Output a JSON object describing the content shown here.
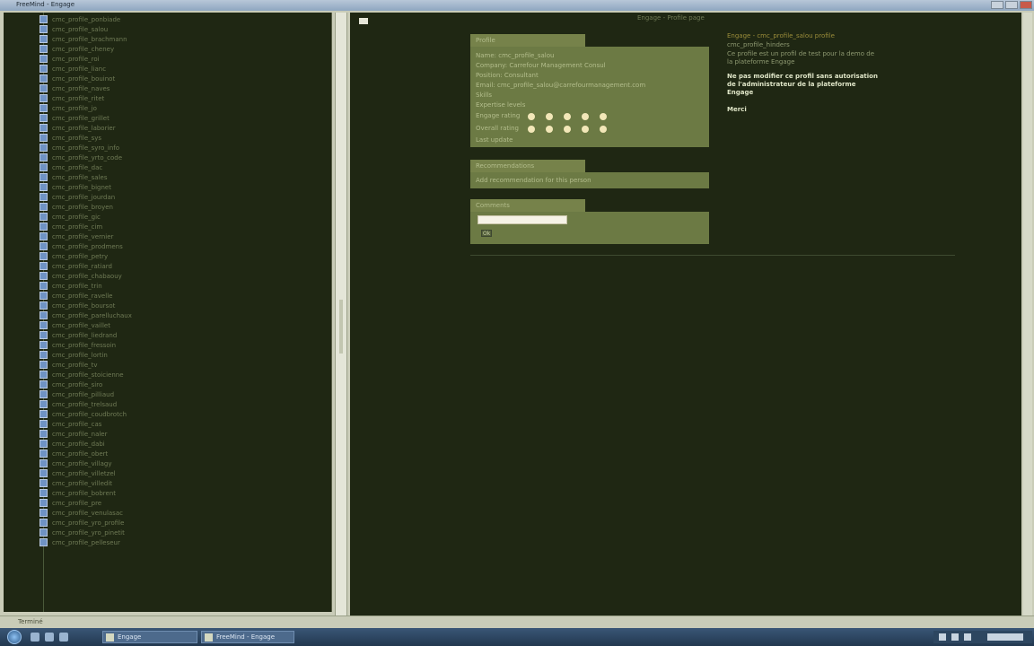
{
  "window": {
    "title": "FreeMind - Engage"
  },
  "tree": {
    "items": [
      "cmc_profile_ponbiade",
      "cmc_profile_salou",
      "cmc_profile_brachmann",
      "cmc_profile_cheney",
      "cmc_profile_roi",
      "cmc_profile_lianc",
      "cmc_profile_bouinot",
      "cmc_profile_naves",
      "cmc_profile_ritet",
      "cmc_profile_jo",
      "cmc_profile_grillet",
      "cmc_profile_laborier",
      "cmc_profile_sys",
      "cmc_profile_syro_info",
      "cmc_profile_yrto_code",
      "cmc_profile_dac",
      "cmc_profile_sales",
      "cmc_profile_bignet",
      "cmc_profile_jourdan",
      "cmc_profile_broyen",
      "cmc_profile_gic",
      "cmc_profile_cim",
      "cmc_profile_vernier",
      "cmc_profile_prodmens",
      "cmc_profile_petry",
      "cmc_profile_ratiard",
      "cmc_profile_chabaouy",
      "cmc_profile_trin",
      "cmc_profile_ravelle",
      "cmc_profile_boursot",
      "cmc_profile_parelluchaux",
      "cmc_profile_vaillet",
      "cmc_profile_liedrand",
      "cmc_profile_fressoin",
      "cmc_profile_lortin",
      "cmc_profile_tv",
      "cmc_profile_stoicienne",
      "cmc_profile_siro",
      "cmc_profile_pilliaud",
      "cmc_profile_trelsaud",
      "cmc_profile_coudbrotch",
      "cmc_profile_cas",
      "cmc_profile_naler",
      "cmc_profile_dabi",
      "cmc_profile_obert",
      "cmc_profile_villagy",
      "cmc_profile_villetzel",
      "cmc_profile_villedit",
      "cmc_profile_bobrent",
      "cmc_profile_pre",
      "cmc_profile_venulasac",
      "cmc_profile_yro_profile",
      "cmc_profile_yro_pinetit",
      "cmc_profile_pelleseur"
    ]
  },
  "header": {
    "center_heading": "Engage - Profile page"
  },
  "panel1": {
    "tab": "Profile",
    "lines": [
      "Name: cmc_profile_salou",
      "Company: Carrefour Management Consul",
      "Position: Consultant",
      "Email: cmc_profile_salou@carrefourmanagement.com",
      "Skills",
      "Expertise levels",
      "Engage rating",
      "Overall rating",
      "Last update"
    ]
  },
  "panel2": {
    "tab": "Recommendations",
    "line": "Add recommendation for this person"
  },
  "panel3": {
    "tab": "Comments",
    "button": "Ok"
  },
  "sidebar": {
    "title": "Engage - cmc_profile_salou profile",
    "line1": "cmc_profile_hinders",
    "line2": "Ce profile est un profil de test pour la demo de",
    "line3": "la plateforme Engage",
    "strong1": "Ne pas modifier ce profil sans autorisation",
    "strong2": "de l'administrateur de la plateforme",
    "strong3": "Engage",
    "strong4": "Merci"
  },
  "status": {
    "text": "Terminé"
  },
  "taskbar": {
    "task1": "Engage",
    "task2": "FreeMind - Engage"
  }
}
